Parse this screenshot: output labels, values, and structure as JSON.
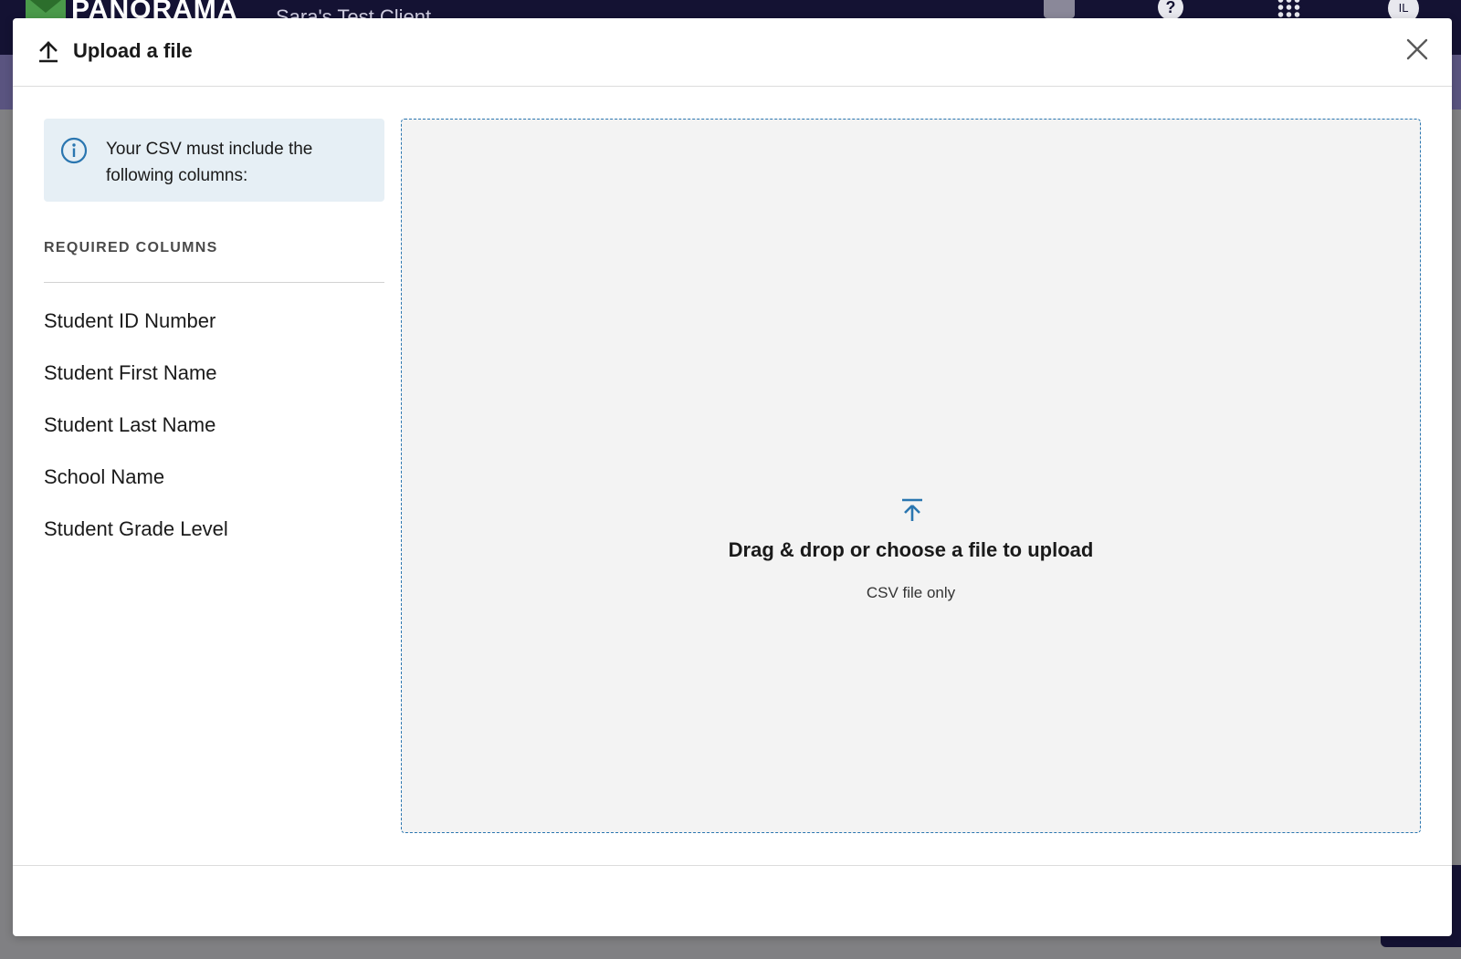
{
  "app": {
    "logo_text": "PANORAMA",
    "client_name": "Sara's Test Client",
    "help_label": "?",
    "avatar_initials": "IL"
  },
  "modal": {
    "title": "Upload a file",
    "header_icon": "upload-icon",
    "close_icon": "close-icon"
  },
  "info": {
    "icon": "info-icon",
    "text": "Your CSV must include the following columns:"
  },
  "required": {
    "heading": "REQUIRED COLUMNS",
    "columns": [
      "Student ID Number",
      "Student First Name",
      "Student Last Name",
      "School Name",
      "Student Grade Level"
    ]
  },
  "dropzone": {
    "icon": "upload-arrow-icon",
    "title": "Drag & drop or choose a file to upload",
    "subtitle": "CSV file only"
  },
  "colors": {
    "accent": "#2a76b0",
    "info_bg": "#e6eff5",
    "app_header": "#141233",
    "app_subbar": "#5a5480"
  }
}
